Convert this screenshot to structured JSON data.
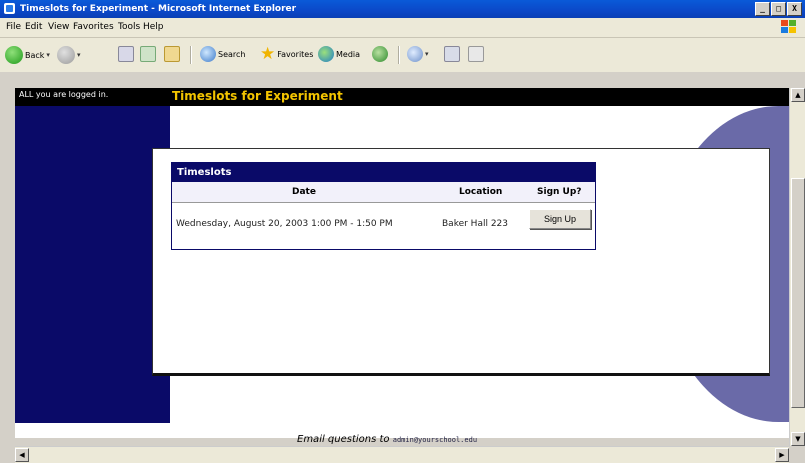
{
  "window": {
    "title": "Timeslots for Experiment - Microsoft Internet Explorer",
    "buttons": {
      "minimize": "_",
      "maximize": "□",
      "close": "X"
    }
  },
  "menubar": {
    "items": [
      "File",
      "Edit",
      "View",
      "Favorites",
      "Tools",
      "Help"
    ]
  },
  "toolbar": {
    "back_label": "Back",
    "search_label": "Search",
    "favorites_label": "Favorites",
    "media_label": "Media"
  },
  "page": {
    "logged_in_text": "ALL you are logged in.",
    "title": "Timeslots for Experiment",
    "accent_color": "#f3c400",
    "nav_color": "#0a0a68"
  },
  "timeslots": {
    "header": "Timeslots",
    "columns": {
      "date": "Date",
      "location": "Location",
      "signup": "Sign Up?"
    },
    "rows": [
      {
        "date": "Wednesday, August 20, 2003 1:00 PM - 1:50 PM",
        "location": "Baker Hall 223",
        "button": "Sign Up"
      }
    ]
  },
  "footer": {
    "text": "Email questions to",
    "email": "admin@yourschool.edu"
  }
}
